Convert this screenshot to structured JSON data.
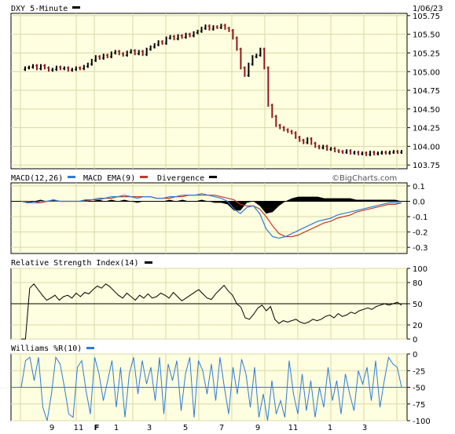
{
  "header": {
    "symbol_title": "DXY 5-Minute",
    "date": "1/06/23",
    "brand": "©BigCharts.com"
  },
  "colors": {
    "panel_bg": "#FEFEE0",
    "grid": "#D9D9A6",
    "price_up": "#000000",
    "price_down": "#8B1A1A",
    "macd_line": "#2F7BD6",
    "signal_line": "#C0392B",
    "histogram": "#000000",
    "indicator_line": "#000000",
    "williams_line": "#2F7BD6"
  },
  "chart_data": [
    {
      "type": "line",
      "title": "DXY 5-Minute",
      "series": [
        {
          "name": "DXY 5-Minute",
          "x": [
            0,
            5,
            10,
            15,
            20,
            25,
            30,
            35,
            40,
            45,
            50,
            55,
            60,
            65,
            70,
            75,
            80,
            85,
            90,
            95,
            100,
            105,
            110,
            115,
            120,
            125,
            130,
            135,
            140,
            145,
            150,
            155,
            160,
            165,
            170,
            175,
            180,
            185,
            190,
            195,
            200,
            205,
            210,
            215,
            220,
            225,
            230,
            235,
            240,
            245,
            250,
            255,
            260,
            265,
            270,
            275,
            280,
            285,
            290,
            295,
            300,
            305,
            310,
            315,
            320,
            325,
            330,
            335,
            340,
            345,
            350,
            355,
            360,
            365,
            370,
            375,
            380,
            385,
            390,
            395,
            400,
            405,
            410,
            415,
            420,
            425,
            430,
            435,
            440,
            445,
            450,
            455,
            460,
            465,
            470,
            475,
            480,
            485
          ],
          "values": [
            105.03,
            105.05,
            105.06,
            105.08,
            105.04,
            105.08,
            105.05,
            105.02,
            105.03,
            105.06,
            105.04,
            105.05,
            105.02,
            105.03,
            105.05,
            105.04,
            105.07,
            105.1,
            105.15,
            105.2,
            105.18,
            105.22,
            105.2,
            105.25,
            105.27,
            105.24,
            105.22,
            105.26,
            105.28,
            105.24,
            105.27,
            105.23,
            105.3,
            105.33,
            105.36,
            105.4,
            105.38,
            105.45,
            105.47,
            105.44,
            105.48,
            105.46,
            105.5,
            105.48,
            105.52,
            105.54,
            105.58,
            105.61,
            105.57,
            105.6,
            105.59,
            105.62,
            105.58,
            105.55,
            105.45,
            105.3,
            105.05,
            104.95,
            105.1,
            105.2,
            105.22,
            105.3,
            105.05,
            104.55,
            104.4,
            104.28,
            104.25,
            104.22,
            104.2,
            104.18,
            104.12,
            104.08,
            104.05,
            104.1,
            104.04,
            104.0,
            103.98,
            104.0,
            103.96,
            103.97,
            103.94,
            103.93,
            103.92,
            103.94,
            103.91,
            103.92,
            103.9,
            103.91,
            103.89,
            103.92,
            103.9,
            103.91,
            103.92,
            103.91,
            103.92,
            103.93,
            103.92,
            103.93
          ]
        }
      ],
      "ylim": [
        103.7,
        105.78
      ],
      "yticks": [
        "105.75",
        "105.50",
        "105.25",
        "105.00",
        "104.75",
        "104.50",
        "104.25",
        "104.00",
        "103.75"
      ]
    },
    {
      "type": "line",
      "title": "MACD(12,26)",
      "legend": [
        "MACD(12,26)",
        "MACD EMA(9)",
        "Divergence"
      ],
      "series": [
        {
          "name": "MACD(12,26)",
          "values": [
            0.0,
            -0.01,
            -0.01,
            0.0,
            0.0,
            0.01,
            0.0,
            0.0,
            0.0,
            0.0,
            0.01,
            0.01,
            0.02,
            0.02,
            0.03,
            0.03,
            0.04,
            0.03,
            0.02,
            0.03,
            0.03,
            0.02,
            0.02,
            0.03,
            0.03,
            0.04,
            0.04,
            0.04,
            0.05,
            0.04,
            0.03,
            0.02,
            0.0,
            -0.05,
            -0.08,
            -0.04,
            -0.03,
            -0.08,
            -0.18,
            -0.23,
            -0.24,
            -0.23,
            -0.21,
            -0.19,
            -0.17,
            -0.15,
            -0.13,
            -0.12,
            -0.11,
            -0.09,
            -0.08,
            -0.07,
            -0.06,
            -0.05,
            -0.04,
            -0.03,
            -0.02,
            -0.01,
            -0.01,
            -0.01
          ]
        },
        {
          "name": "MACD EMA(9)",
          "values": [
            0.0,
            0.0,
            -0.01,
            -0.01,
            0.0,
            0.0,
            0.0,
            0.0,
            0.0,
            0.0,
            0.0,
            0.01,
            0.01,
            0.02,
            0.02,
            0.03,
            0.03,
            0.03,
            0.03,
            0.03,
            0.03,
            0.02,
            0.02,
            0.02,
            0.03,
            0.03,
            0.04,
            0.04,
            0.04,
            0.04,
            0.04,
            0.03,
            0.02,
            0.01,
            -0.02,
            -0.03,
            -0.03,
            -0.05,
            -0.1,
            -0.16,
            -0.21,
            -0.23,
            -0.23,
            -0.22,
            -0.2,
            -0.18,
            -0.16,
            -0.14,
            -0.13,
            -0.11,
            -0.1,
            -0.09,
            -0.07,
            -0.06,
            -0.05,
            -0.04,
            -0.03,
            -0.02,
            -0.02,
            -0.01
          ]
        },
        {
          "name": "Divergence",
          "values": [
            0.0,
            -0.01,
            0.0,
            0.01,
            0.0,
            0.01,
            0.0,
            0.0,
            0.0,
            0.0,
            0.01,
            0.0,
            0.01,
            0.0,
            0.01,
            0.0,
            0.01,
            0.0,
            -0.01,
            0.0,
            0.0,
            0.0,
            0.0,
            0.01,
            0.0,
            0.01,
            0.0,
            0.0,
            0.01,
            0.0,
            -0.01,
            -0.01,
            -0.02,
            -0.06,
            -0.06,
            -0.01,
            0.0,
            -0.03,
            -0.08,
            -0.07,
            -0.03,
            0.0,
            0.02,
            0.03,
            0.03,
            0.03,
            0.03,
            0.02,
            0.02,
            0.02,
            0.02,
            0.02,
            0.01,
            0.01,
            0.01,
            0.01,
            0.01,
            0.01,
            0.01,
            0.0
          ]
        }
      ],
      "ylim": [
        -0.34,
        0.12
      ],
      "yticks": [
        "0.1",
        "0.0",
        "-0.1",
        "-0.2",
        "-0.3"
      ]
    },
    {
      "type": "line",
      "title": "Relative Strength Index(14)",
      "series": [
        {
          "name": "Relative Strength Index(14)",
          "values": [
            0,
            0,
            72,
            78,
            70,
            62,
            55,
            58,
            62,
            55,
            60,
            62,
            58,
            65,
            60,
            66,
            64,
            70,
            75,
            72,
            78,
            74,
            68,
            62,
            58,
            65,
            60,
            55,
            62,
            58,
            64,
            58,
            60,
            65,
            62,
            58,
            66,
            60,
            54,
            58,
            62,
            66,
            70,
            64,
            58,
            56,
            64,
            70,
            76,
            68,
            62,
            50,
            45,
            30,
            28,
            35,
            44,
            48,
            40,
            46,
            28,
            22,
            26,
            24,
            26,
            28,
            24,
            22,
            24,
            28,
            26,
            28,
            32,
            34,
            30,
            36,
            32,
            34,
            38,
            36,
            40,
            42,
            44,
            42,
            46,
            48,
            50,
            48,
            50,
            52,
            48
          ],
          "annotation_start_from_zero": true
        }
      ],
      "ylim": [
        0,
        100
      ],
      "yticks": [
        "100",
        "80",
        "50",
        "20",
        "0"
      ]
    },
    {
      "type": "line",
      "title": "Williams %R(10)",
      "series": [
        {
          "name": "Williams %R(10)",
          "values": [
            -50,
            -10,
            -5,
            -40,
            -5,
            -80,
            -100,
            -60,
            -5,
            -15,
            -50,
            -90,
            -95,
            -20,
            -10,
            -55,
            -90,
            -5,
            -30,
            -70,
            -40,
            -10,
            -80,
            -20,
            -95,
            -30,
            -5,
            -60,
            -10,
            -45,
            -20,
            -70,
            -5,
            -90,
            -15,
            -40,
            -10,
            -85,
            -30,
            -5,
            -95,
            -10,
            -25,
            -60,
            -15,
            -70,
            -5,
            -50,
            -90,
            -20,
            -60,
            -8,
            -30,
            -80,
            -20,
            -95,
            -60,
            -100,
            -40,
            -90,
            -70,
            -95,
            -10,
            -60,
            -90,
            -30,
            -85,
            -40,
            -95,
            -50,
            -80,
            -20,
            -70,
            -40,
            -90,
            -30,
            -60,
            -85,
            -25,
            -45,
            -20,
            -70,
            -10,
            -80,
            -40,
            -5,
            -15,
            -20,
            -50
          ],
          "reference_level": -50
        }
      ],
      "ylim": [
        -100,
        0
      ],
      "yticks": [
        "0",
        "-25",
        "-50",
        "-75",
        "-100"
      ]
    }
  ],
  "x_axis": {
    "tick_labels": [
      "9",
      "11",
      "F",
      "1",
      "3",
      "5",
      "7",
      "9",
      "11",
      "1",
      "3"
    ],
    "bold_labels": [
      "F"
    ]
  }
}
